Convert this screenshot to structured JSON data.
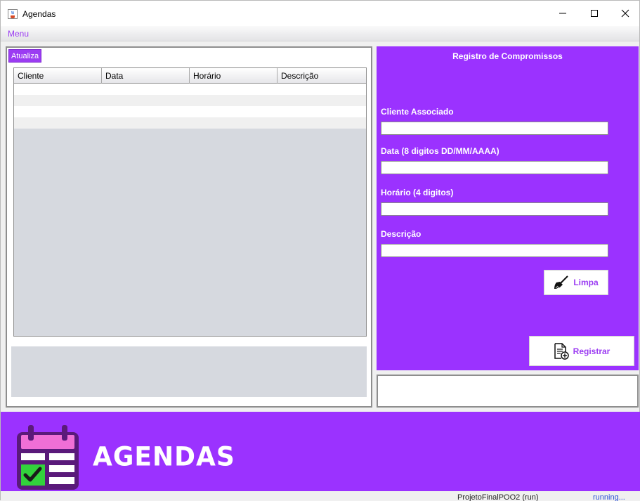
{
  "window": {
    "title": "Agendas",
    "icon": "java-cup-icon",
    "controls": [
      "minimize-icon",
      "maximize-icon",
      "close-icon"
    ]
  },
  "menubar": {
    "menu_label": "Menu"
  },
  "left_panel": {
    "refresh_label": "Atualiza",
    "table": {
      "columns": [
        "Cliente",
        "Data",
        "Horário",
        "Descrição"
      ],
      "rows": []
    }
  },
  "form": {
    "title": "Registro de Compromissos",
    "fields": [
      {
        "label": "Cliente Associado",
        "value": ""
      },
      {
        "label": "Data (8 digitos DD/MM/AAAA)",
        "value": ""
      },
      {
        "label": "Horário (4 digitos)",
        "value": ""
      },
      {
        "label": "Descrição",
        "value": ""
      }
    ],
    "clear_label": "Limpa",
    "clear_icon": "broom-icon",
    "register_label": "Registrar",
    "register_icon": "document-add-icon"
  },
  "banner": {
    "title": "AGENDAS",
    "icon": "calendar-check-icon"
  },
  "taskbar": {
    "left_text": "ProjetoFinalPOO2 (run)",
    "right_text": "running..."
  },
  "colors": {
    "accent": "#9b32ff",
    "accent_text": "#9b3cf2",
    "pink": "#f06fd6",
    "green": "#32d23c",
    "dark_purple": "#5a1a7a"
  }
}
